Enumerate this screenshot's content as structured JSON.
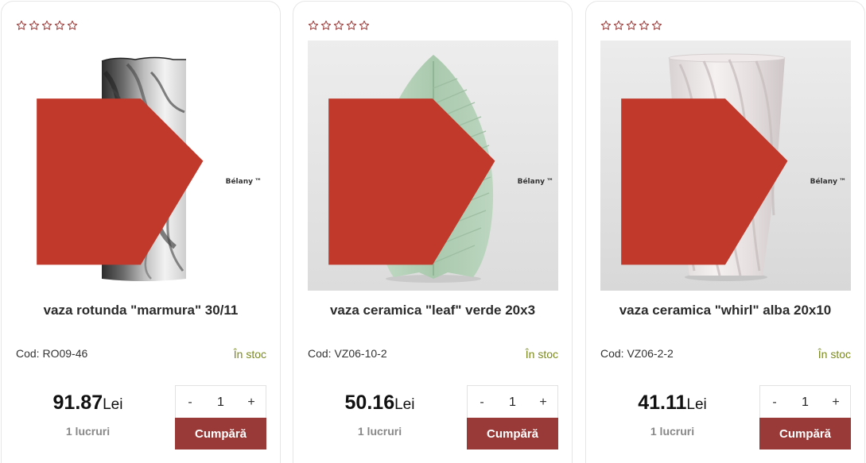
{
  "products": [
    {
      "title": "vaza rotunda \"marmura\" 30/11",
      "code": "Cod: RO09-46",
      "stock": "În stoc",
      "price_value": "91.87",
      "price_currency": "Lei",
      "units": "1 lucruri",
      "quantity": "1",
      "qty_minus": "-",
      "qty_plus": "+",
      "buy_label": "Cumpără",
      "brand": "Bélany",
      "image_icon": "marble-vase-image",
      "rating": 0
    },
    {
      "title": "vaza ceramica \"leaf\" verde 20x3",
      "code": "Cod: VZ06-10-2",
      "stock": "În stoc",
      "price_value": "50.16",
      "price_currency": "Lei",
      "units": "1 lucruri",
      "quantity": "1",
      "qty_minus": "-",
      "qty_plus": "+",
      "buy_label": "Cumpără",
      "brand": "Bélany",
      "image_icon": "leaf-vase-image",
      "rating": 0
    },
    {
      "title": "vaza ceramica \"whirl\" alba 20x10",
      "code": "Cod: VZ06-2-2",
      "stock": "În stoc",
      "price_value": "41.11",
      "price_currency": "Lei",
      "units": "1 lucruri",
      "quantity": "1",
      "qty_minus": "-",
      "qty_plus": "+",
      "buy_label": "Cumpără",
      "brand": "Bélany",
      "image_icon": "whirl-vase-image",
      "rating": 0
    }
  ],
  "colors": {
    "accent": "#9a3a38",
    "stock": "#7b8a1e",
    "star_outline": "#9a3a38"
  }
}
